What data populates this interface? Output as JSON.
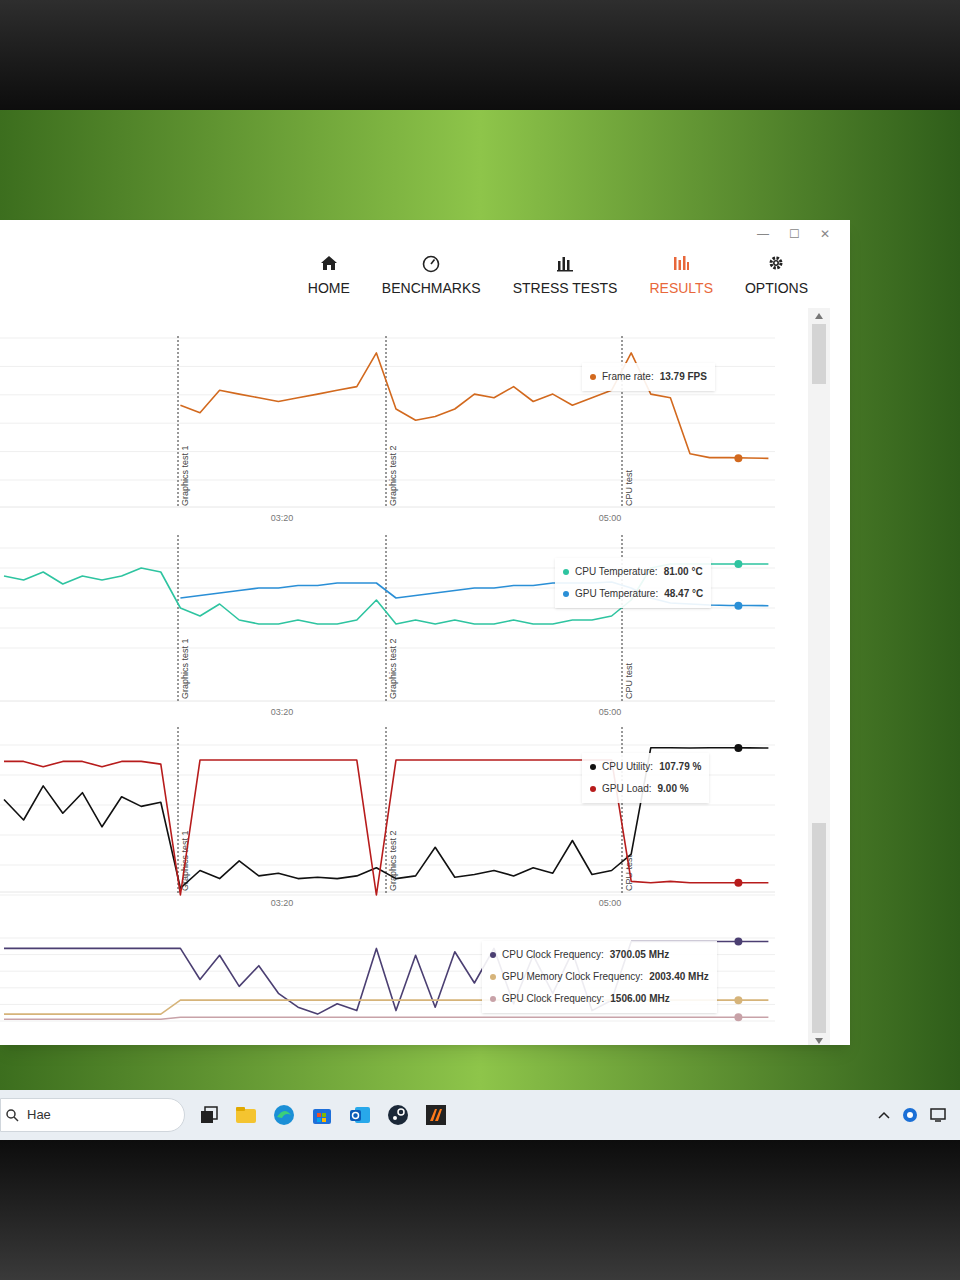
{
  "window": {
    "controls": [
      "—",
      "☐",
      "✕"
    ]
  },
  "nav": [
    {
      "label": "HOME",
      "kind": "home",
      "selected": false
    },
    {
      "label": "BENCHMARKS",
      "kind": "benchmarks",
      "selected": false
    },
    {
      "label": "STRESS TESTS",
      "kind": "stress",
      "selected": false
    },
    {
      "label": "RESULTS",
      "kind": "results",
      "selected": true
    },
    {
      "label": "OPTIONS",
      "kind": "options",
      "selected": false
    }
  ],
  "charts": [
    {
      "markers": [
        "Graphics test 1",
        "Graphics test 2",
        "CPU test"
      ],
      "ticks": [
        "03:20",
        "05:00"
      ],
      "series": [
        {
          "label": "Frame rate:",
          "value": "13.79 FPS",
          "color": "#d2691e",
          "values": [
            null,
            null,
            null,
            null,
            null,
            null,
            null,
            null,
            null,
            28,
            26,
            32,
            31,
            30,
            29,
            30,
            31,
            32,
            33,
            42,
            27,
            24,
            25,
            27,
            31,
            30,
            33,
            29,
            31,
            28,
            30,
            32,
            42,
            31,
            30,
            15,
            14,
            14,
            13.9,
            13.79
          ]
        }
      ]
    },
    {
      "markers": [
        "Graphics test 1",
        "Graphics test 2",
        "CPU test"
      ],
      "ticks": [
        "03:20",
        "05:00"
      ],
      "series": [
        {
          "label": "CPU Temperature:",
          "value": "81.00 °C",
          "color": "#2ec4a0",
          "values": [
            78,
            77,
            79,
            76,
            78,
            77,
            78,
            80,
            79,
            70,
            68,
            71,
            67,
            66,
            66,
            67,
            66,
            66,
            67,
            72,
            66,
            67,
            66,
            67,
            66,
            66,
            67,
            66,
            66,
            67,
            67,
            68,
            72,
            80,
            81,
            81,
            81,
            81,
            81,
            81
          ]
        },
        {
          "label": "GPU Temperature:",
          "value": "48.47 °C",
          "color": "#2a8fd6",
          "values": [
            null,
            null,
            null,
            null,
            null,
            null,
            null,
            null,
            null,
            50,
            50.5,
            51,
            51.5,
            52,
            52,
            52.5,
            52.5,
            53,
            53,
            53,
            50,
            50.5,
            51,
            51.5,
            52,
            52,
            52.5,
            52.5,
            53,
            53,
            53,
            53.2,
            52,
            50,
            49,
            48.8,
            48.6,
            48.5,
            48.5,
            48.47
          ]
        }
      ]
    },
    {
      "markers": [
        "Graphics test 1",
        "Graphics test 2",
        "CPU test"
      ],
      "ticks": [
        "03:20",
        "05:00"
      ],
      "series": [
        {
          "label": "CPU Utility:",
          "value": "107.79 %",
          "color": "#111111",
          "values": [
            70,
            55,
            80,
            60,
            75,
            50,
            72,
            65,
            68,
            5,
            18,
            12,
            25,
            14,
            16,
            12,
            13,
            12,
            14,
            20,
            12,
            14,
            35,
            13,
            15,
            18,
            14,
            20,
            16,
            40,
            15,
            18,
            30,
            108,
            108,
            107.8,
            108,
            108,
            107.9,
            107.79
          ]
        },
        {
          "label": "GPU Load:",
          "value": "9.00 %",
          "color": "#b71c1c",
          "values": [
            98,
            98,
            94,
            98,
            98,
            94,
            98,
            98,
            96,
            0,
            99,
            99,
            99,
            99,
            99,
            99,
            99,
            99,
            99,
            0,
            99,
            99,
            99,
            99,
            99,
            99,
            99,
            99,
            99,
            99,
            99,
            99,
            10,
            9,
            10,
            9,
            9,
            9,
            9,
            9
          ]
        }
      ]
    },
    {
      "markers": [],
      "ticks": [],
      "series": [
        {
          "label": "CPU Clock Frequency:",
          "value": "3700.05 MHz",
          "color": "#4b3f72",
          "values": [
            3500,
            3500,
            3500,
            3500,
            3500,
            3500,
            3500,
            3500,
            3500,
            3500,
            2600,
            3300,
            2400,
            3000,
            2200,
            1800,
            1600,
            1900,
            1700,
            3500,
            1700,
            3300,
            1800,
            3400,
            2500,
            3500,
            1900,
            3300,
            2200,
            3400,
            1700,
            2000,
            3700,
            3700,
            3700,
            3700,
            3700,
            3700,
            3700,
            3700.05
          ]
        },
        {
          "label": "GPU Memory Clock Frequency:",
          "value": "2003.40 MHz",
          "color": "#d6b47a",
          "values": [
            1600,
            1600,
            1600,
            1600,
            1600,
            1600,
            1600,
            1600,
            1600,
            2003.4,
            2003.4,
            2003.4,
            2003.4,
            2003.4,
            2003.4,
            2003.4,
            2003.4,
            2003.4,
            2003.4,
            2003.4,
            2003.4,
            2003.4,
            2003.4,
            2003.4,
            2003.4,
            2003.4,
            2003.4,
            2003.4,
            2003.4,
            2003.4,
            2003.4,
            2003.4,
            2003.4,
            2003.4,
            2003.4,
            2003.4,
            2003.4,
            2003.4,
            2003.4,
            2003.4
          ]
        },
        {
          "label": "GPU Clock Frequency:",
          "value": "1506.00 MHz",
          "color": "#c8a2a8",
          "values": [
            1450,
            1450,
            1450,
            1450,
            1450,
            1450,
            1450,
            1450,
            1450,
            1506,
            1506,
            1506,
            1506,
            1506,
            1506,
            1506,
            1506,
            1506,
            1506,
            1506,
            1506,
            1506,
            1506,
            1506,
            1506,
            1506,
            1506,
            1506,
            1506,
            1506,
            1506,
            1506,
            1506,
            1506,
            1506,
            1506,
            1506,
            1506,
            1506,
            1506
          ]
        }
      ]
    }
  ],
  "taskbar": {
    "search": {
      "placeholder": "Hae"
    }
  }
}
